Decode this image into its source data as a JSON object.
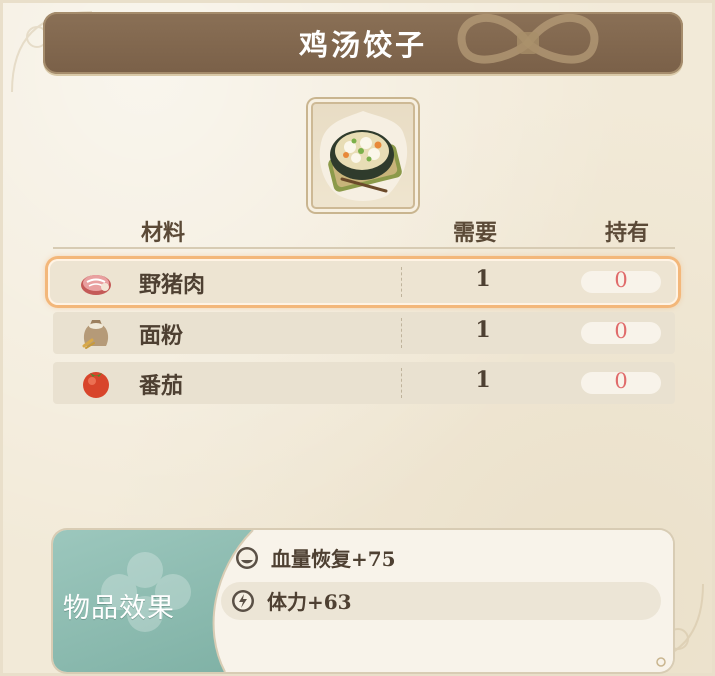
{
  "recipe": {
    "title": "鸡汤饺子"
  },
  "table": {
    "headers": {
      "material": "材料",
      "need": "需要",
      "have": "持有"
    },
    "rows": [
      {
        "icon": "boar-meat-icon",
        "name": "野猪肉",
        "need": "1",
        "have": "0",
        "selected": true
      },
      {
        "icon": "flour-sack-icon",
        "name": "面粉",
        "need": "1",
        "have": "0",
        "selected": false
      },
      {
        "icon": "tomato-icon",
        "name": "番茄",
        "need": "1",
        "have": "0",
        "selected": false
      }
    ]
  },
  "effects": {
    "title": "物品效果",
    "items": [
      {
        "icon": "hp-restore-icon",
        "text": "血量恢复+75"
      },
      {
        "icon": "stamina-bolt-icon",
        "text": "体力+63"
      }
    ]
  },
  "colors": {
    "banner": "#7a6048",
    "selection_glow": "#f3b77a",
    "shortage_red": "#e06b6b",
    "effect_teal": "#8dbcb1"
  }
}
